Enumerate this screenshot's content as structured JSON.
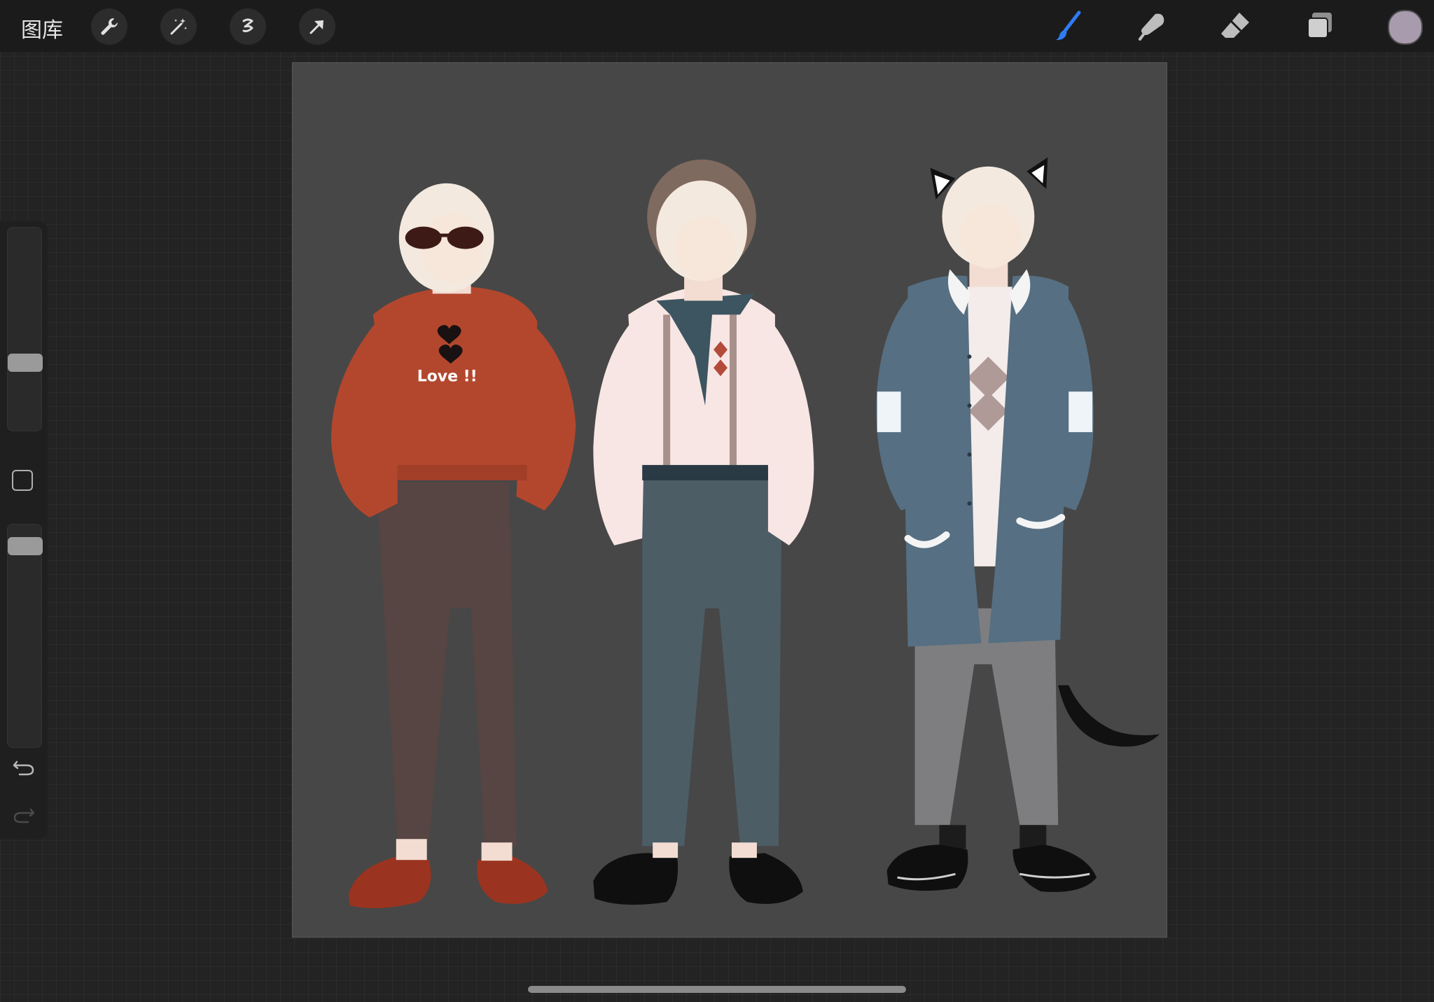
{
  "toolbar": {
    "gallery_label": "图库",
    "left_tools": [
      "wrench-icon",
      "magic-wand-icon",
      "selection-icon",
      "transform-arrow-icon"
    ],
    "right_tools": [
      "brush-icon",
      "smudge-icon",
      "eraser-icon",
      "layers-icon"
    ],
    "active_tool": "brush-icon",
    "accent_color": "#2f7bf5",
    "current_color": "#a99bae"
  },
  "sidebar": {
    "brush_size_level": 0.68,
    "opacity_level": 0.94
  },
  "canvas": {
    "background_color": "#474747",
    "artwork_text": "Love !!"
  }
}
